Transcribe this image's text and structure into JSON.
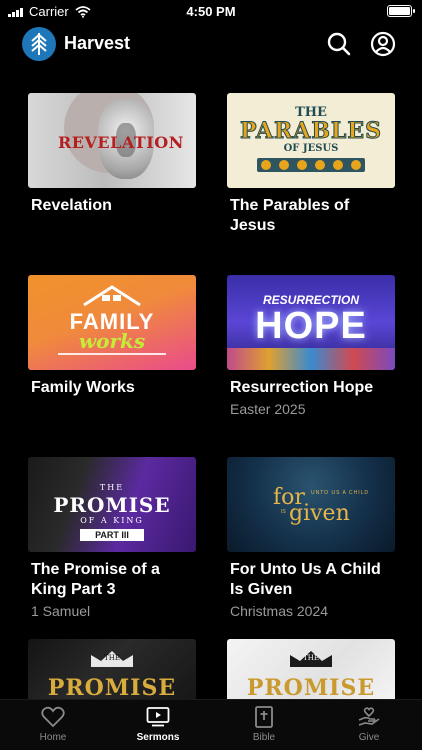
{
  "status": {
    "carrier": "Carrier",
    "time": "4:50 PM"
  },
  "header": {
    "title": "Harvest",
    "logo_icon": "harvest-logo-icon",
    "search_icon": "search-icon",
    "profile_icon": "profile-icon"
  },
  "series": [
    {
      "title": "Revelation",
      "subtitle": "",
      "art_text": "REVELATION"
    },
    {
      "title": "The Parables of Jesus",
      "subtitle": "",
      "art_text": {
        "line1": "THE",
        "line2": "PARABLES",
        "line3": "OF JESUS"
      }
    },
    {
      "title": "Family Works",
      "subtitle": "",
      "art_text": {
        "line1": "FAMILY",
        "line2": "works"
      }
    },
    {
      "title": "Resurrection Hope",
      "subtitle": "Easter 2025",
      "art_text": {
        "line1": "RESURRECTION",
        "line2": "HOPE"
      }
    },
    {
      "title": "The Promise of a King Part 3",
      "subtitle": "1 Samuel",
      "art_text": {
        "line1": "THE",
        "line2": "PROMISE",
        "line3": "OF A KING",
        "line4": "PART III"
      }
    },
    {
      "title": "For Unto Us A Child Is Given",
      "subtitle": "Christmas 2024",
      "art_text": {
        "line1": "for",
        "line2": "UNTO US A CHILD",
        "line3": "IS",
        "line4": "given"
      }
    },
    {
      "title": "",
      "subtitle": "",
      "art_text": {
        "line1": "THE",
        "line2": "PROMISE"
      }
    },
    {
      "title": "",
      "subtitle": "",
      "art_text": {
        "line1": "THE",
        "line2": "PROMISE"
      }
    }
  ],
  "tabs": [
    {
      "label": "Home",
      "icon": "heart-icon",
      "active": false
    },
    {
      "label": "Sermons",
      "icon": "play-screen-icon",
      "active": true
    },
    {
      "label": "Bible",
      "icon": "bible-icon",
      "active": false
    },
    {
      "label": "Give",
      "icon": "give-icon",
      "active": false
    }
  ],
  "colors": {
    "background": "#000000",
    "accent": "#1d77b8",
    "subtitle": "#9a9a9a"
  }
}
